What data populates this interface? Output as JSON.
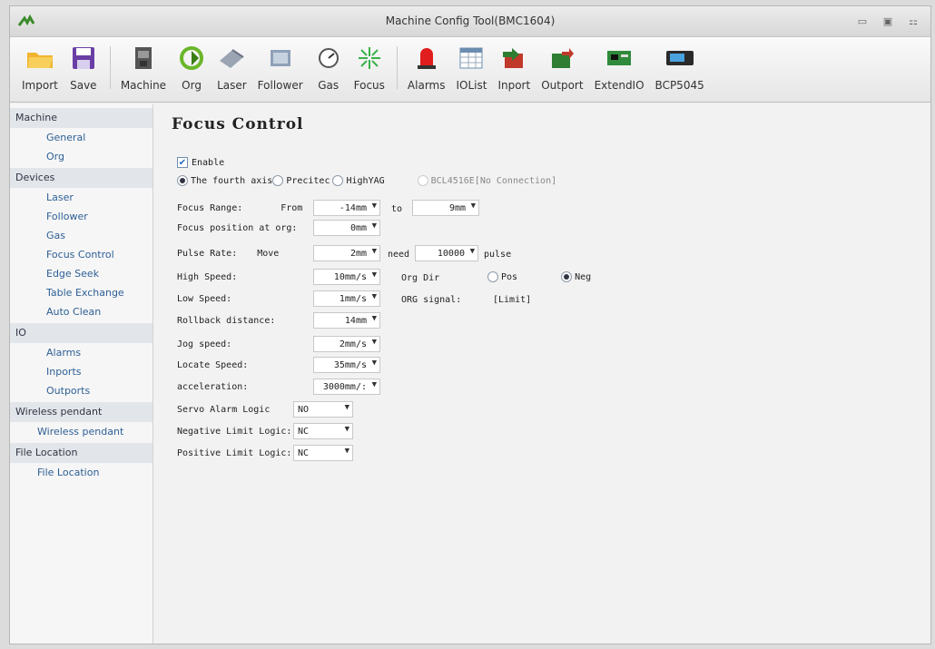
{
  "window": {
    "title": "Machine Config Tool(BMC1604)"
  },
  "toolbar": [
    {
      "label": "Import",
      "icon": "folder-icon"
    },
    {
      "label": "Save",
      "icon": "floppy-icon"
    },
    {
      "label": "Machine",
      "icon": "machine-icon"
    },
    {
      "label": "Org",
      "icon": "arrow-icon"
    },
    {
      "label": "Laser",
      "icon": "laser-icon"
    },
    {
      "label": "Follower",
      "icon": "follower-icon"
    },
    {
      "label": "Gas",
      "icon": "gauge-icon"
    },
    {
      "label": "Focus",
      "icon": "focus-icon"
    },
    {
      "label": "Alarms",
      "icon": "alarm-light-icon"
    },
    {
      "label": "IOList",
      "icon": "table-icon"
    },
    {
      "label": "Inport",
      "icon": "inport-icon"
    },
    {
      "label": "Outport",
      "icon": "outport-icon"
    },
    {
      "label": "ExtendIO",
      "icon": "board-icon"
    },
    {
      "label": "BCP5045",
      "icon": "device-icon"
    }
  ],
  "sidebar": {
    "groups": [
      {
        "label": "Machine",
        "items": [
          "General",
          "Org"
        ]
      },
      {
        "label": "Devices",
        "items": [
          "Laser",
          "Follower",
          "Gas",
          "Focus Control",
          "Edge Seek",
          "Table Exchange",
          "Auto Clean"
        ]
      },
      {
        "label": "IO",
        "items": [
          "Alarms",
          "Inports",
          "Outports"
        ]
      },
      {
        "label": "Wireless pendant",
        "items": [
          "Wireless pendant"
        ]
      },
      {
        "label": "File Location",
        "items": [
          "File Location"
        ]
      }
    ]
  },
  "page": {
    "title": "Focus Control",
    "enable_label": "Enable",
    "modes": {
      "fourth_axis": "The fourth axis",
      "precitec": "Precitec",
      "highyag": "HighYAG",
      "bcl": "BCL4516E[No Connection]"
    },
    "focus_range": {
      "label": "Focus Range:",
      "from": "From",
      "from_value": "-14mm",
      "to": "to",
      "to_value": "9mm"
    },
    "focus_pos": {
      "label": "Focus position at org:",
      "value": "0mm"
    },
    "pulse_rate": {
      "label": "Pulse Rate:",
      "move": "Move",
      "move_value": "2mm",
      "need": "need",
      "need_value": "10000",
      "pulse": "pulse"
    },
    "high_speed": {
      "label": "High Speed:",
      "value": "10mm/s"
    },
    "low_speed": {
      "label": "Low Speed:",
      "value": "1mm/s"
    },
    "org_dir": {
      "label": "Org Dir",
      "pos": "Pos",
      "neg": "Neg"
    },
    "org_signal": {
      "label": "ORG signal:",
      "value": "[Limit]"
    },
    "rollback": {
      "label": "Rollback distance:",
      "value": "14mm"
    },
    "jog": {
      "label": "Jog speed:",
      "value": "2mm/s"
    },
    "locate": {
      "label": "Locate Speed:",
      "value": "35mm/s"
    },
    "accel": {
      "label": "acceleration:",
      "value": "3000mm/:"
    },
    "servo": {
      "label": "Servo Alarm Logic",
      "value": "NO"
    },
    "neg_limit": {
      "label": "Negative Limit Logic:",
      "value": "NC"
    },
    "pos_limit": {
      "label": "Positive Limit Logic:",
      "value": "NC"
    }
  }
}
